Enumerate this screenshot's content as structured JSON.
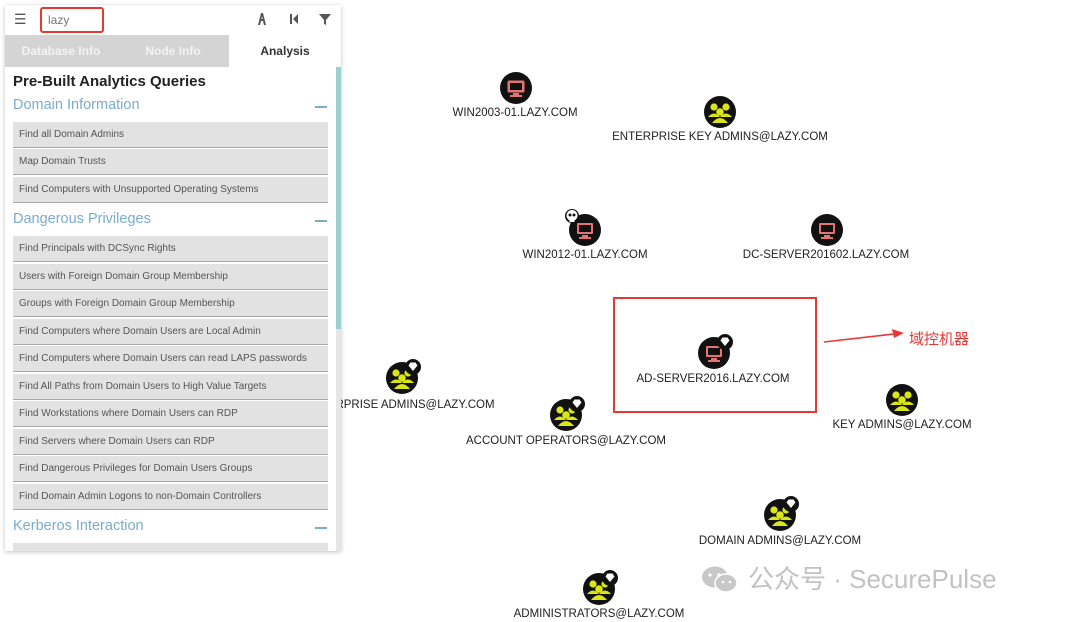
{
  "search": {
    "value": "lazy"
  },
  "tabs": [
    {
      "label": "Database Info"
    },
    {
      "label": "Node Info"
    },
    {
      "label": "Analysis"
    }
  ],
  "panel": {
    "title": "Pre-Built Analytics Queries",
    "sections": [
      {
        "title": "Domain Information",
        "queries": [
          "Find all Domain Admins",
          "Map Domain Trusts",
          "Find Computers with Unsupported Operating Systems"
        ]
      },
      {
        "title": "Dangerous Privileges",
        "queries": [
          "Find Principals with DCSync Rights",
          "Users with Foreign Domain Group Membership",
          "Groups with Foreign Domain Group Membership",
          "Find Computers where Domain Users are Local Admin",
          "Find Computers where Domain Users can read LAPS passwords",
          "Find All Paths from Domain Users to High Value Targets",
          "Find Workstations where Domain Users can RDP",
          "Find Servers where Domain Users can RDP",
          "Find Dangerous Privileges for Domain Users Groups",
          "Find Domain Admin Logons to non-Domain Controllers"
        ]
      },
      {
        "title": "Kerberos Interaction",
        "queries": []
      }
    ]
  },
  "graph": {
    "nodes": [
      {
        "label": "WIN2003-01.LAZY.COM",
        "kind": "computer",
        "icon": "computer-icon"
      },
      {
        "label": "ENTERPRISE KEY ADMINS@LAZY.COM",
        "kind": "group",
        "icon": "group-icon"
      },
      {
        "label": "WIN2012-01.LAZY.COM",
        "kind": "computer",
        "icon": "computer-icon",
        "badge": "skull-icon"
      },
      {
        "label": "DC-SERVER201602.LAZY.COM",
        "kind": "computer",
        "icon": "computer-icon"
      },
      {
        "label": "AD-SERVER2016.LAZY.COM",
        "kind": "computer",
        "icon": "computer-icon",
        "badge": "diamond-icon"
      },
      {
        "label": "RPRISE ADMINS@LAZY.COM",
        "kind": "group",
        "icon": "group-icon",
        "badge": "diamond-icon"
      },
      {
        "label": "ACCOUNT OPERATORS@LAZY.COM",
        "kind": "group",
        "icon": "group-icon",
        "badge": "diamond-icon"
      },
      {
        "label": "KEY ADMINS@LAZY.COM",
        "kind": "group",
        "icon": "group-icon"
      },
      {
        "label": "DOMAIN ADMINS@LAZY.COM",
        "kind": "group",
        "icon": "group-icon",
        "badge": "diamond-icon"
      },
      {
        "label": "ADMINISTRATORS@LAZY.COM",
        "kind": "group",
        "icon": "group-icon",
        "badge": "diamond-icon"
      }
    ],
    "annotation": "域控机器"
  },
  "watermark": "公众号 · SecurePulse",
  "colors": {
    "computer_fill": "#e57373",
    "group_fill": "#dbe617",
    "node_border": "#111111",
    "accent_blue": "#7aaccd",
    "annotation_red": "#e53935"
  }
}
